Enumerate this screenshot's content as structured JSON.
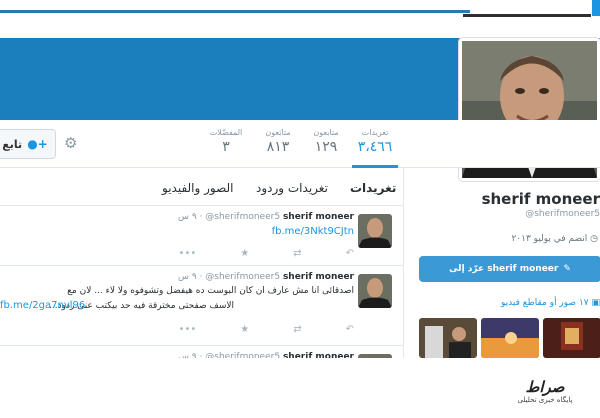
{
  "profile": {
    "name": "sherif moneer",
    "handle": "@sherifmoneer5",
    "joined": "انضم في يوليو ٢٠١٣"
  },
  "nav": {
    "follow_label": "تابع",
    "stats": [
      {
        "label": "تغريدات",
        "value": "٣،٤٦٦",
        "active": true
      },
      {
        "label": "متابعون",
        "value": "١٢٩"
      },
      {
        "label": "متابَعون",
        "value": "٨١٣"
      },
      {
        "label": "المفضّلات",
        "value": "٣"
      }
    ]
  },
  "tabs": [
    "تغريدات",
    "تغريدات وردود",
    "الصور والفيديو"
  ],
  "tweets": [
    {
      "name": "sherif moneer",
      "handle": "@sherifmoneer5",
      "time": "٩ س",
      "lines": [],
      "link": "fb.me/3Nkt9CJtn"
    },
    {
      "name": "sherif moneer",
      "handle": "@sherifmoneer5",
      "time": "٩ س",
      "lines": [
        "اصدقائى انا مش عارف ان كان البوست ده  هيفضل وتشوفوه ولا لاء ... لان مع",
        "الاسف صفحتى مخترقة  فيه  حد بيكتب عنى ردود..."
      ],
      "link": "fb.me/2ga7nvl96"
    },
    {
      "name": "sherif moneer",
      "handle": "@sherifmoneer5",
      "time": "٩ س",
      "lines": [],
      "link": ""
    }
  ],
  "side": {
    "tweet_to_button": "عرّد إلى sherif moneer",
    "media_header": "١٧ صور أو مقاطع فيديو"
  },
  "watermark": {
    "brand": "صراط",
    "caption": "پایگاه خبری تحلیلی"
  },
  "icons": {
    "reply": "reply-icon",
    "retweet": "retweet-icon",
    "favorite": "star-icon",
    "more": "more-icon"
  },
  "colors": {
    "banner": "#1b7fbd",
    "accent": "#1b95e0",
    "button": "#3b9ad6"
  }
}
